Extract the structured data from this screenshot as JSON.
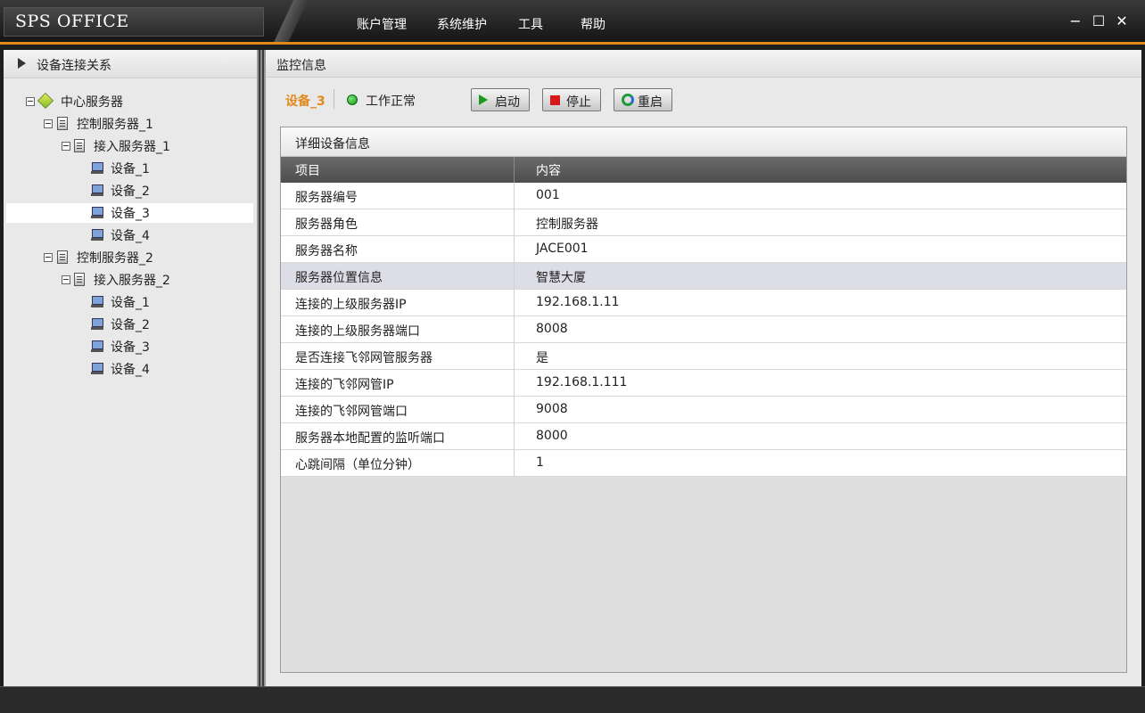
{
  "app": {
    "title": "SPS OFFICE"
  },
  "menu": [
    "账户管理",
    "系统维护",
    "工具",
    "帮助"
  ],
  "window_controls": {
    "minimize": "−",
    "maximize": "☐",
    "close": "✕"
  },
  "left_panel": {
    "title": "设备连接关系",
    "tree": [
      {
        "label": "中心服务器",
        "level": 0,
        "kind": "root",
        "expandable": true
      },
      {
        "label": "控制服务器_1",
        "level": 1,
        "kind": "server",
        "expandable": true
      },
      {
        "label": "接入服务器_1",
        "level": 2,
        "kind": "server",
        "expandable": true
      },
      {
        "label": "设备_1",
        "level": 3,
        "kind": "device"
      },
      {
        "label": "设备_2",
        "level": 3,
        "kind": "device"
      },
      {
        "label": "设备_3",
        "level": 3,
        "kind": "device",
        "selected": true
      },
      {
        "label": "设备_4",
        "level": 3,
        "kind": "device"
      },
      {
        "label": "控制服务器_2",
        "level": 1,
        "kind": "server",
        "expandable": true
      },
      {
        "label": "接入服务器_2",
        "level": 2,
        "kind": "server",
        "expandable": true
      },
      {
        "label": "设备_1",
        "level": 3,
        "kind": "device"
      },
      {
        "label": "设备_2",
        "level": 3,
        "kind": "device"
      },
      {
        "label": "设备_3",
        "level": 3,
        "kind": "device"
      },
      {
        "label": "设备_4",
        "level": 3,
        "kind": "device"
      }
    ]
  },
  "right_panel": {
    "title": "监控信息",
    "device_name": "设备_3",
    "status_text": "工作正常",
    "status_color": "#11aa11",
    "buttons": {
      "start": "启动",
      "stop": "停止",
      "restart": "重启"
    },
    "detail": {
      "title": "详细设备信息",
      "columns": [
        "项目",
        "内容"
      ],
      "rows": [
        [
          "服务器编号",
          "001"
        ],
        [
          "服务器角色",
          "控制服务器"
        ],
        [
          "服务器名称",
          "JACE001"
        ],
        [
          "服务器位置信息",
          "智慧大厦"
        ],
        [
          "连接的上级服务器IP",
          "192.168.1.11"
        ],
        [
          "连接的上级服务器端口",
          "8008"
        ],
        [
          "是否连接飞邻网管服务器",
          "是"
        ],
        [
          "连接的飞邻网管IP",
          "192.168.1.111"
        ],
        [
          "连接的飞邻网管端口",
          "9008"
        ],
        [
          "服务器本地配置的监听端口",
          "8000"
        ],
        [
          "心跳间隔（单位分钟）",
          "1"
        ]
      ],
      "highlighted_row": 3
    }
  },
  "colors": {
    "accent": "#e08a1c"
  }
}
